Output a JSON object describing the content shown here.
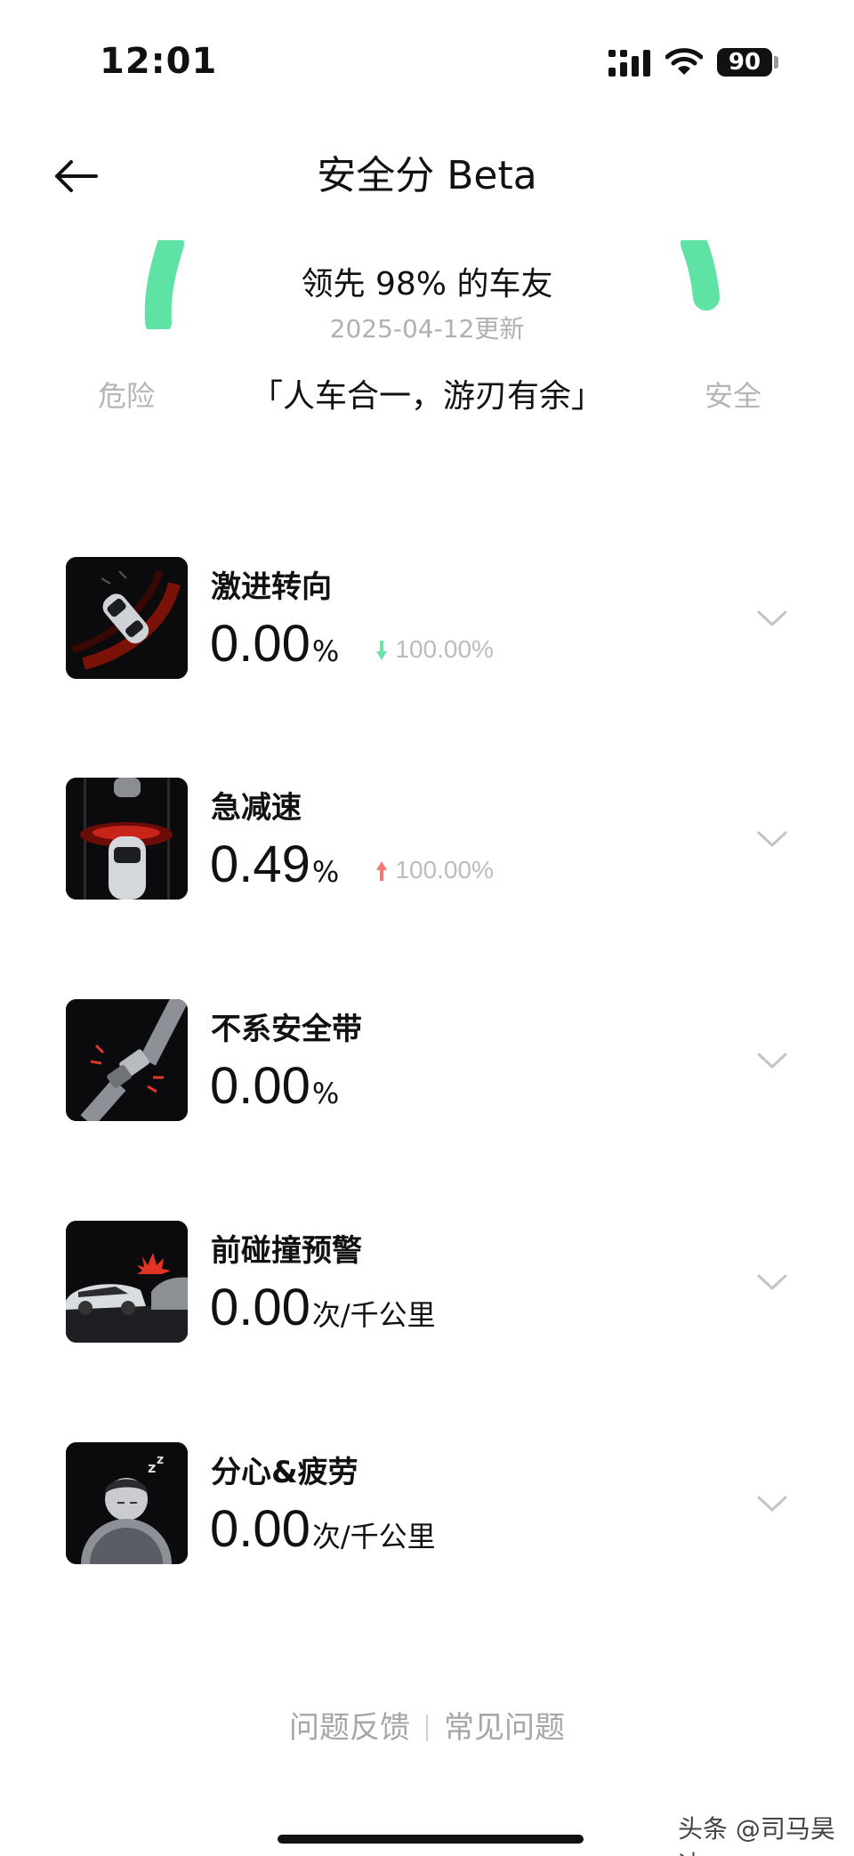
{
  "status_bar": {
    "time": "12:01",
    "battery": "90"
  },
  "header": {
    "title": "安全分 Beta"
  },
  "score": {
    "rank_text": "领先 98% 的车友",
    "updated": "2025-04-12更新",
    "gauge_left_label": "危险",
    "gauge_right_label": "安全",
    "slogan": "「人车合一，游刃有余」",
    "gauge_color": "#5ee3a4"
  },
  "metrics": [
    {
      "name": "激进转向",
      "value": "0.00",
      "unit": "%",
      "change": "100.00%",
      "change_direction": "down",
      "change_color": "#5ee3a4",
      "icon": "sharp-turn-icon"
    },
    {
      "name": "急减速",
      "value": "0.49",
      "unit": "%",
      "change": "100.00%",
      "change_direction": "up",
      "change_color": "#f07a72",
      "icon": "hard-brake-icon"
    },
    {
      "name": "不系安全带",
      "value": "0.00",
      "unit": "%",
      "change": "",
      "icon": "seatbelt-icon"
    },
    {
      "name": "前碰撞预警",
      "value": "0.00",
      "unit": "次/千公里",
      "change": "",
      "icon": "collision-warning-icon"
    },
    {
      "name": "分心&疲劳",
      "value": "0.00",
      "unit": "次/千公里",
      "change": "",
      "icon": "fatigue-icon"
    }
  ],
  "footer": {
    "feedback": "问题反馈",
    "faq": "常见问题"
  },
  "watermark": "头条 @司马昊迪"
}
